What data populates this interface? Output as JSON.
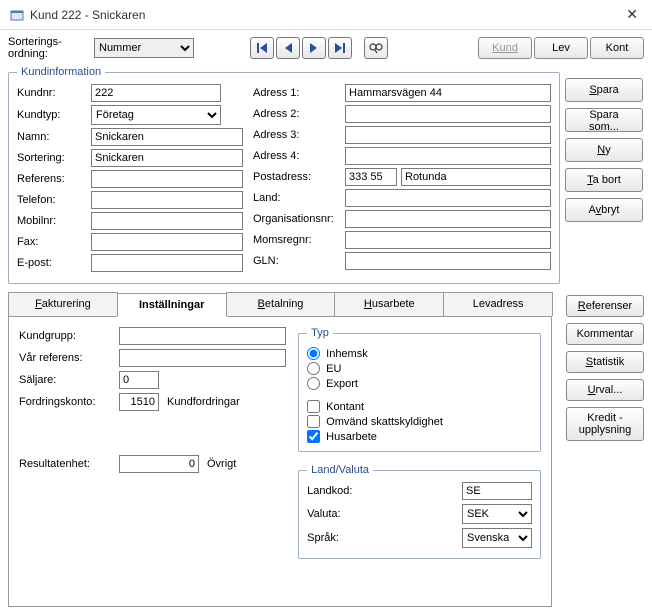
{
  "window": {
    "title": "Kund 222 - Snickaren"
  },
  "sort": {
    "label": "Sorterings-\nordning:",
    "label1": "Sorterings-",
    "label2": "ordning:",
    "value": "Nummer"
  },
  "topbtns": {
    "kund": "Kund",
    "lev": "Lev",
    "kont": "Kont"
  },
  "groupbox": {
    "title": "Kundinformation"
  },
  "left": {
    "kundnr": {
      "label": "Kundnr:",
      "value": "222"
    },
    "kundtyp": {
      "label": "Kundtyp:",
      "value": "Företag"
    },
    "namn": {
      "label": "Namn:",
      "value": "Snickaren"
    },
    "sortering": {
      "label": "Sortering:",
      "value": "Snickaren"
    },
    "referens": {
      "label": "Referens:",
      "value": ""
    },
    "telefon": {
      "label": "Telefon:",
      "value": ""
    },
    "mobilnr": {
      "label": "Mobilnr:",
      "value": ""
    },
    "fax": {
      "label": "Fax:",
      "value": ""
    },
    "epost": {
      "label": "E-post:",
      "value": ""
    }
  },
  "right": {
    "adress1": {
      "label": "Adress 1:",
      "value": "Hammarsvägen 44"
    },
    "adress2": {
      "label": "Adress 2:",
      "value": ""
    },
    "adress3": {
      "label": "Adress 3:",
      "value": ""
    },
    "adress4": {
      "label": "Adress 4:",
      "value": ""
    },
    "post": {
      "label": "Postadress:",
      "zip": "333 55",
      "city": "Rotunda"
    },
    "land": {
      "label": "Land:",
      "value": ""
    },
    "orgnr": {
      "label": "Organisationsnr:",
      "value": ""
    },
    "momsregnr": {
      "label": "Momsregnr:",
      "value": ""
    },
    "gln": {
      "label": "GLN:",
      "value": ""
    }
  },
  "sidebtns": {
    "spara": "Spara",
    "sparasom": "Spara som...",
    "ny": "Ny",
    "tabort": "Ta bort",
    "avbryt": "Avbryt"
  },
  "tabs": {
    "fakturering": "Fakturering",
    "installningar": "Inställningar",
    "betalning": "Betalning",
    "husarbete": "Husarbete",
    "levadress": "Levadress"
  },
  "settings": {
    "kundgrupp": {
      "label": "Kundgrupp:",
      "value": ""
    },
    "varrefer": {
      "label": "Vår referens:",
      "value": ""
    },
    "saljare": {
      "label": "Säljare:",
      "value": "0"
    },
    "fordring": {
      "label": "Fordringskonto:",
      "code": "1510",
      "name": "Kundfordringar"
    },
    "resultenh": {
      "label": "Resultatenhet:",
      "code": "0",
      "name": "Övrigt"
    }
  },
  "typ": {
    "title": "Typ",
    "inhemsk": "Inhemsk",
    "eu": "EU",
    "export": "Export",
    "kontant": "Kontant",
    "omvand": "Omvänd skattskyldighet",
    "husarbete": "Husarbete"
  },
  "landvaluta": {
    "title": "Land/Valuta",
    "landkod": {
      "label": "Landkod:",
      "value": "SE"
    },
    "valuta": {
      "label": "Valuta:",
      "value": "SEK"
    },
    "sprak": {
      "label": "Språk:",
      "value": "Svenska"
    }
  },
  "rightbtns": {
    "referenser": "Referenser",
    "kommentar": "Kommentar",
    "statistik": "Statistik",
    "urval": "Urval...",
    "kredit": "Kredit -\nupplysning",
    "kredit1": "Kredit -",
    "kredit2": "upplysning"
  }
}
